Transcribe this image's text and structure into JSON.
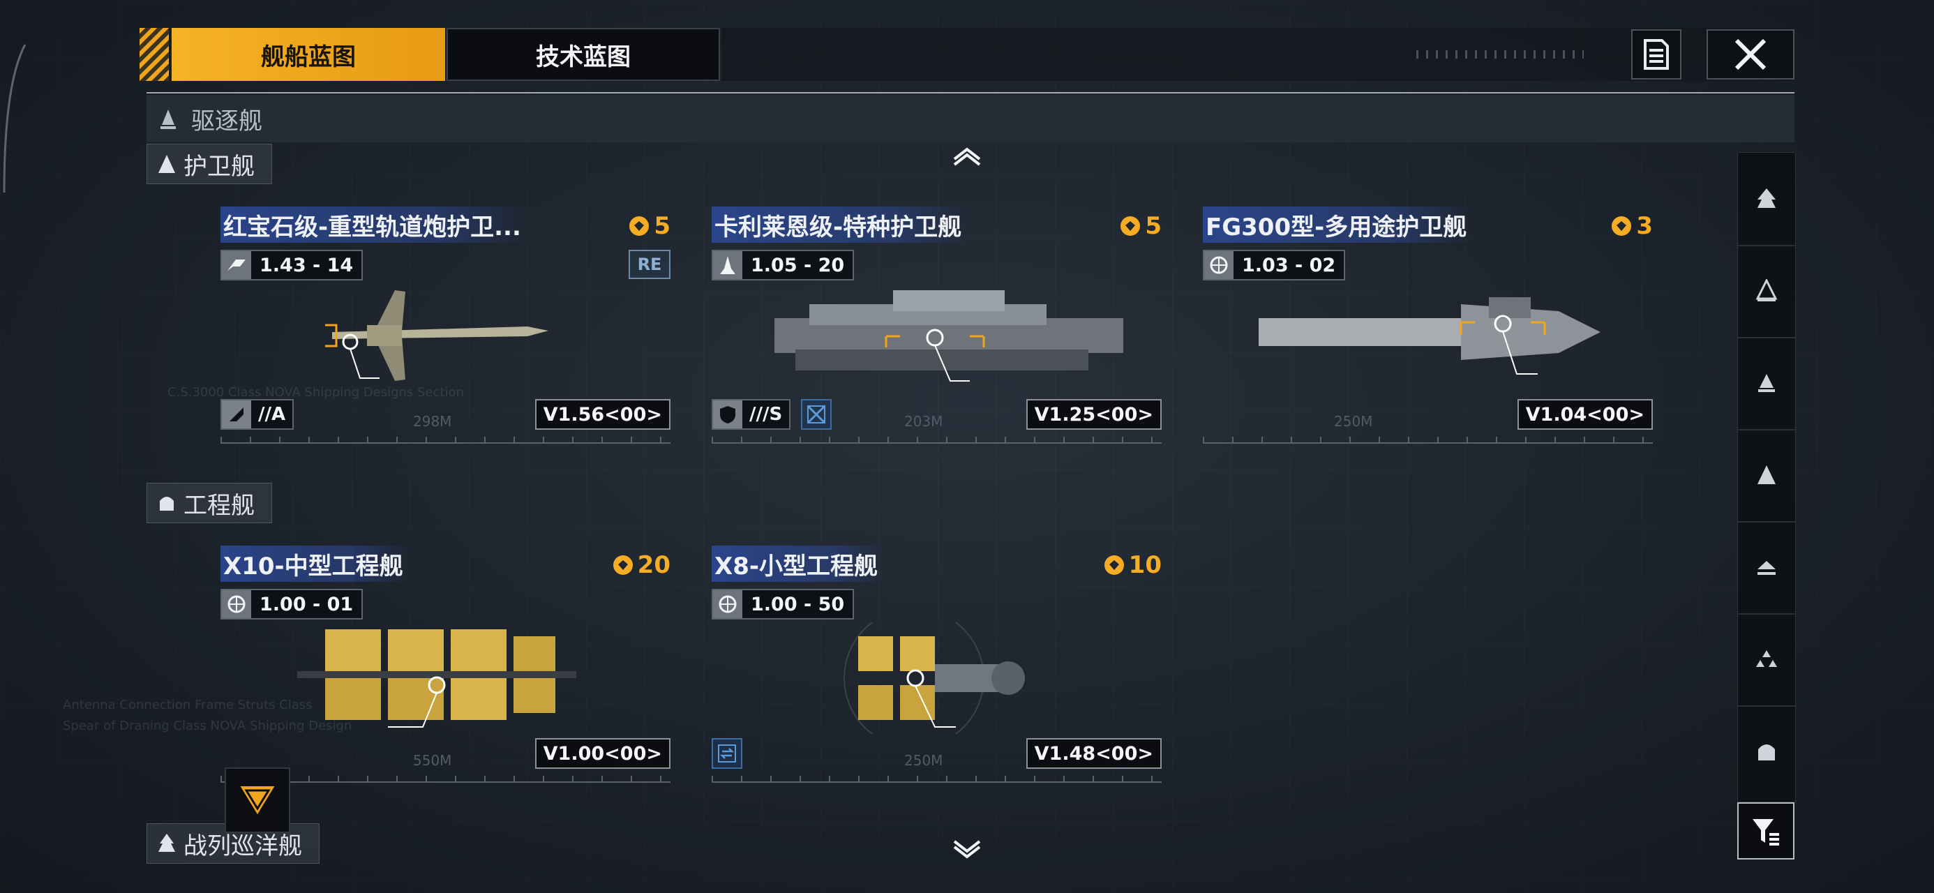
{
  "tabs": [
    {
      "label": "舰船蓝图",
      "active": true
    },
    {
      "label": "技术蓝图",
      "active": false
    }
  ],
  "icons": {
    "doc": "document-icon",
    "close": "close-icon",
    "filter": "filter-icon",
    "scroll_up": "chevron-up-icon",
    "scroll_down": "chevron-down-icon"
  },
  "colors": {
    "accent": "#f0a51c",
    "title_band": "#2c4894",
    "cost": "#f4ad24"
  },
  "sections": {
    "destroyer": "驱逐舰",
    "frigate": "护卫舰",
    "engineering": "工程舰",
    "battlecruiser": "战列巡洋舰"
  },
  "cards": [
    {
      "title": "红宝石级-重型轨道炮护卫...",
      "cost": "5",
      "ver_tag": "1.43 - 14",
      "re_badge": "RE",
      "role": "//A",
      "length": "298M",
      "version": "V1.56<00>"
    },
    {
      "title": "卡利莱恩级-特种护卫舰",
      "cost": "5",
      "ver_tag": "1.05 - 20",
      "role": "///S",
      "length": "203M",
      "version": "V1.25<00>"
    },
    {
      "title": "FG300型-多用途护卫舰",
      "cost": "3",
      "ver_tag": "1.03 - 02",
      "length": "250M",
      "version": "V1.04<00>"
    },
    {
      "title": "X10-中型工程舰",
      "cost": "20",
      "ver_tag": "1.00 - 01",
      "length": "550M",
      "version": "V1.00<00>"
    },
    {
      "title": "X8-小型工程舰",
      "cost": "10",
      "ver_tag": "1.00 - 50",
      "length": "250M",
      "version": "V1.48<00>"
    }
  ],
  "rail_items": [
    "carrier-class-icon",
    "cruiser-class-icon",
    "destroyer-class-icon",
    "frigate-class-icon",
    "corvette-class-icon",
    "fighter-class-icon",
    "engineering-class-icon"
  ]
}
